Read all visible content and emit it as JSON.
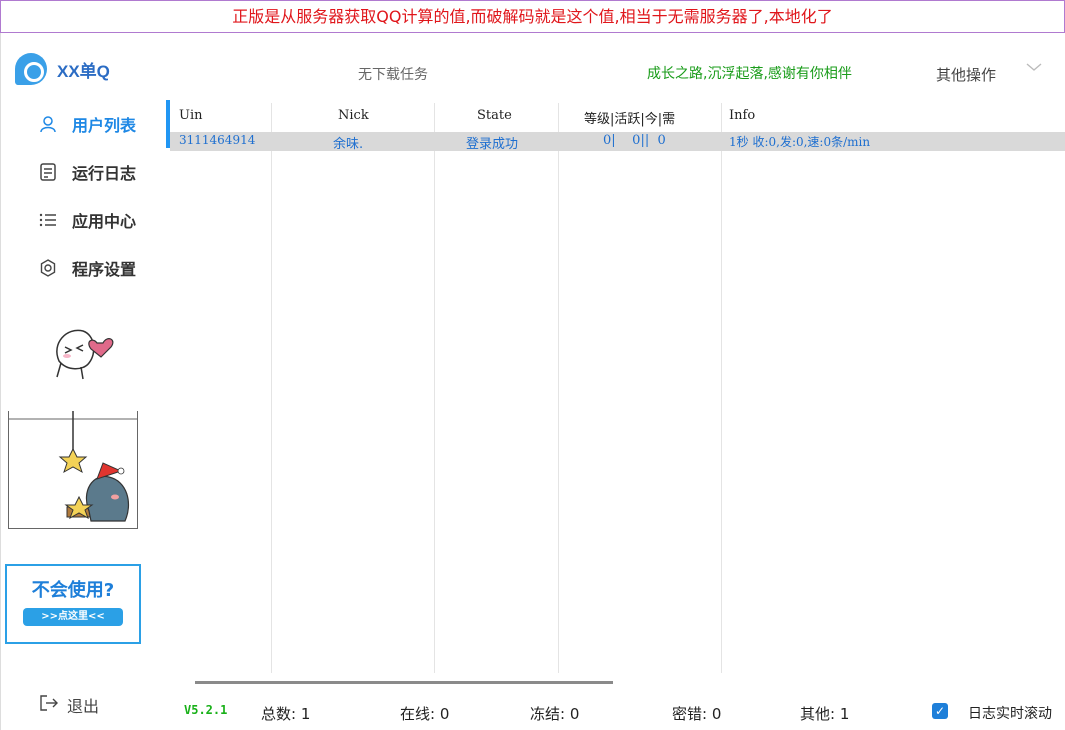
{
  "banner": {
    "text": "正版是从服务器获取QQ计算的值,而破解码就是这个值,相当于无需服务器了,本地化了"
  },
  "app": {
    "title": "XX单Q"
  },
  "sidebar": {
    "items": [
      {
        "label": "用户列表",
        "icon": "user-icon",
        "active": true
      },
      {
        "label": "运行日志",
        "icon": "log-icon",
        "active": false
      },
      {
        "label": "应用中心",
        "icon": "list-icon",
        "active": false
      },
      {
        "label": "程序设置",
        "icon": "gear-icon",
        "active": false
      }
    ],
    "help": {
      "title": "不会使用?",
      "button": ">>点这里<<"
    },
    "logout": {
      "label": "退出",
      "icon": "logout-icon"
    }
  },
  "header": {
    "task_status": "无下载任务",
    "slogan": "成长之路,沉浮起落,感谢有你相伴",
    "other_ops": "其他操作"
  },
  "table": {
    "columns": [
      "Uin",
      "Nick",
      "State",
      "等级|活跃|今|需",
      "Info"
    ],
    "rows": [
      {
        "uin": "3111464914",
        "nick": "余味.",
        "state": "登录成功",
        "level": "0|    0||  0",
        "info": "1秒 收:0,发:0,速:0条/min"
      }
    ]
  },
  "status": {
    "version": "V5.2.1",
    "total": "总数: 1",
    "online": "在线: 0",
    "frozen": "冻结: 0",
    "pwd_error": "密错: 0",
    "other": "其他: 1",
    "log_scroll_label": "日志实时滚动",
    "log_scroll_checked": true
  },
  "colors": {
    "accent": "#2196f3",
    "banner_text": "#e0161b",
    "slogan": "#1a9c1a",
    "version": "#18b018"
  }
}
